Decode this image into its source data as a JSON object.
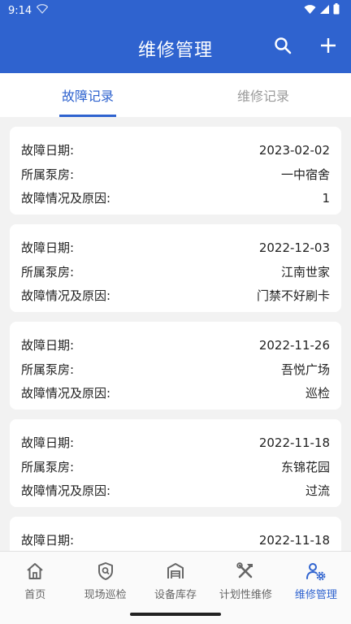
{
  "status": {
    "time": "9:14"
  },
  "appbar": {
    "title": "维修管理",
    "search_icon": "search-icon",
    "add_icon": "add-icon"
  },
  "tabs": [
    {
      "label": "故障记录",
      "active": true
    },
    {
      "label": "维修记录",
      "active": false
    }
  ],
  "labels": {
    "date": "故障日期:",
    "pump": "所属泵房:",
    "reason": "故障情况及原因:"
  },
  "records": [
    {
      "date": "2023-02-02",
      "pump": "一中宿舍",
      "reason": "1"
    },
    {
      "date": "2022-12-03",
      "pump": "江南世家",
      "reason": "门禁不好刷卡"
    },
    {
      "date": "2022-11-26",
      "pump": "吾悦广场",
      "reason": "巡检"
    },
    {
      "date": "2022-11-18",
      "pump": "东锦花园",
      "reason": "过流"
    },
    {
      "date": "2022-11-18",
      "pump": "",
      "reason": ""
    }
  ],
  "nav": [
    {
      "label": "首页",
      "icon": "home-icon",
      "active": false
    },
    {
      "label": "现场巡检",
      "icon": "shield-search-icon",
      "active": false
    },
    {
      "label": "设备库存",
      "icon": "warehouse-icon",
      "active": false
    },
    {
      "label": "计划性维修",
      "icon": "tools-icon",
      "active": false
    },
    {
      "label": "维修管理",
      "icon": "person-gear-icon",
      "active": true
    }
  ],
  "colors": {
    "primary": "#2f63cf",
    "background": "#f2f2f2"
  }
}
